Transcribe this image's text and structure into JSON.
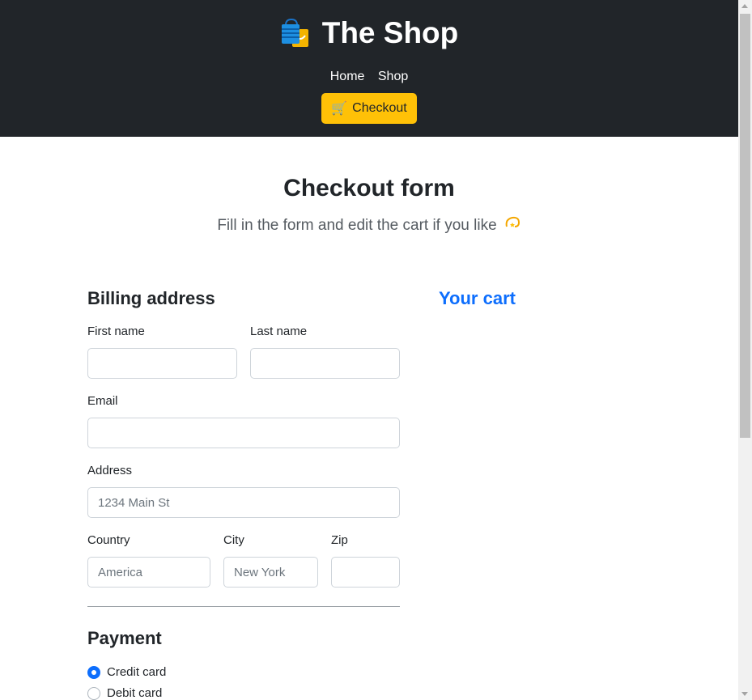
{
  "header": {
    "title": "The Shop",
    "logo_icon": "shopping-bags-icon",
    "nav": [
      {
        "label": "Home"
      },
      {
        "label": "Shop"
      }
    ],
    "checkout_button": {
      "label": "Checkout",
      "icon": "shopping-cart-icon"
    },
    "background": "#212529",
    "button_color": "#ffc107"
  },
  "intro": {
    "title": "Checkout form",
    "lead": "Fill in the form and edit the cart if you like",
    "lead_icon": "dizzy-star-icon"
  },
  "billing": {
    "heading": "Billing address",
    "first_name": {
      "label": "First name",
      "value": "",
      "placeholder": ""
    },
    "last_name": {
      "label": "Last name",
      "value": "",
      "placeholder": ""
    },
    "email": {
      "label": "Email",
      "value": "",
      "placeholder": ""
    },
    "address": {
      "label": "Address",
      "value": "",
      "placeholder": "1234 Main St"
    },
    "country": {
      "label": "Country",
      "value": "",
      "placeholder": "America"
    },
    "city": {
      "label": "City",
      "value": "",
      "placeholder": "New York"
    },
    "zip": {
      "label": "Zip",
      "value": "",
      "placeholder": ""
    }
  },
  "cart": {
    "heading": "Your cart",
    "heading_color": "#0d6efd"
  },
  "payment": {
    "heading": "Payment",
    "options": [
      {
        "label": "Credit card",
        "selected": true
      },
      {
        "label": "Debit card",
        "selected": false
      }
    ],
    "accent": "#0d6efd"
  }
}
